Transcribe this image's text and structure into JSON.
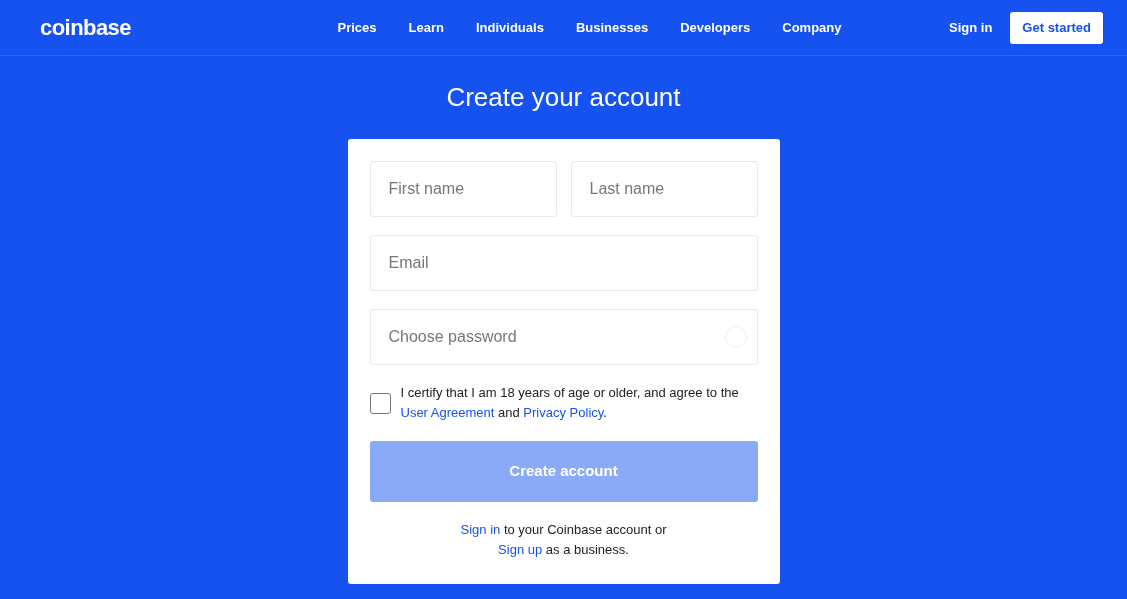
{
  "header": {
    "logo": "coinbase",
    "nav": [
      "Prices",
      "Learn",
      "Individuals",
      "Businesses",
      "Developers",
      "Company"
    ],
    "sign_in": "Sign in",
    "get_started": "Get started"
  },
  "title": "Create your account",
  "form": {
    "first_name": {
      "placeholder": "First name"
    },
    "last_name": {
      "placeholder": "Last name"
    },
    "email": {
      "placeholder": "Email"
    },
    "password": {
      "placeholder": "Choose password"
    },
    "certify": {
      "checked": false,
      "parts": [
        {
          "kind": "text",
          "text": "I certify that I am 18 years of age or older, and agree to the "
        },
        {
          "kind": "link",
          "text": "User Agreement"
        },
        {
          "kind": "text",
          "text": " and "
        },
        {
          "kind": "link",
          "text": "Privacy Policy"
        },
        {
          "kind": "text",
          "text": "."
        }
      ]
    },
    "submit": {
      "label": "Create account",
      "disabled": true
    },
    "footer": [
      [
        {
          "kind": "link",
          "text": "Sign in"
        },
        {
          "kind": "text",
          "text": " to your Coinbase account or"
        }
      ],
      [
        {
          "kind": "link",
          "text": "Sign up"
        },
        {
          "kind": "text",
          "text": " as a business."
        }
      ]
    ]
  }
}
